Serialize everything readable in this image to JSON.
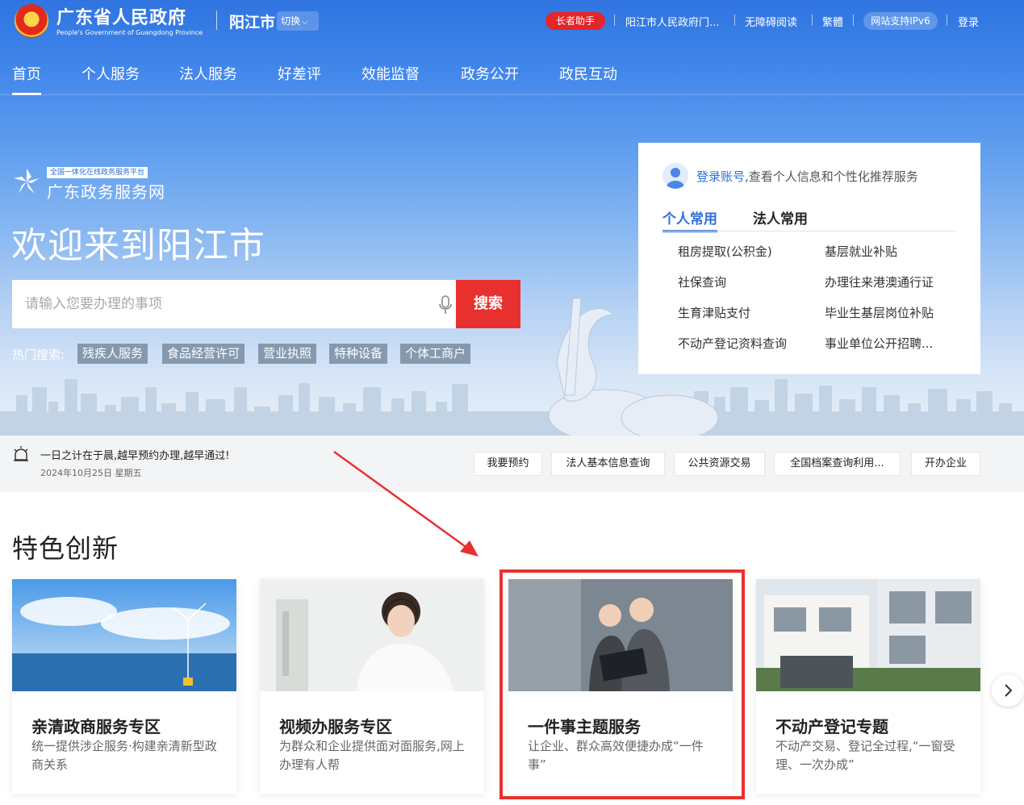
{
  "header": {
    "gov_name": "广东省人民政府",
    "gov_name_en": "People's Government of Guangdong Province",
    "city": "阳江市",
    "switch_label": "切换",
    "elder_mode": "长者助手",
    "links": [
      "阳江市人民政府门...",
      "无障碍阅读",
      "繁體"
    ],
    "ipv6": "网站支持IPv6",
    "login": "登录"
  },
  "nav": [
    "首页",
    "个人服务",
    "法人服务",
    "好差评",
    "效能监督",
    "政务公开",
    "政民互动"
  ],
  "brand": {
    "tag": "全国一体化在线政务服务平台",
    "name": "广东政务服务网"
  },
  "welcome": "欢迎来到阳江市",
  "search": {
    "placeholder": "请输入您要办理的事项",
    "button": "搜索"
  },
  "hot": {
    "label": "热门搜索:",
    "items": [
      "残疾人服务",
      "食品经营许可",
      "营业执照",
      "特种设备",
      "个体工商户"
    ]
  },
  "panel": {
    "login_link": "登录账号",
    "login_text": ",查看个人信息和个性化推荐服务",
    "tabs": [
      "个人常用",
      "法人常用"
    ],
    "items": [
      "租房提取(公积金)",
      "基层就业补贴",
      "社保查询",
      "办理往来港澳通行证",
      "生育津贴支付",
      "毕业生基层岗位补贴",
      "不动产登记资料查询",
      "事业单位公开招聘..."
    ]
  },
  "notice": {
    "text": "一日之计在于晨,越早预约办理,越早通过!",
    "date": "2024年10月25日 星期五"
  },
  "quick": [
    "我要预约",
    "法人基本信息查询",
    "公共资源交易",
    "全国档案查询利用...",
    "开办企业"
  ],
  "featured": {
    "title": "特色创新",
    "cards": [
      {
        "title": "亲清政商服务专区",
        "desc": "统一提供涉企服务·构建亲清新型政商关系"
      },
      {
        "title": "视频办服务专区",
        "desc": "为群众和企业提供面对面服务,网上办理有人帮"
      },
      {
        "title": "一件事主题服务",
        "desc": "让企业、群众高效便捷办成“一件事”"
      },
      {
        "title": "不动产登记专题",
        "desc": "不动产交易、登记全过程,“一窗受理、一次办成”"
      }
    ]
  },
  "colors": {
    "accent": "#2e6fd8",
    "search_red": "#e8312e",
    "elder_red": "#e3262a",
    "highlight": "#e8312e"
  }
}
